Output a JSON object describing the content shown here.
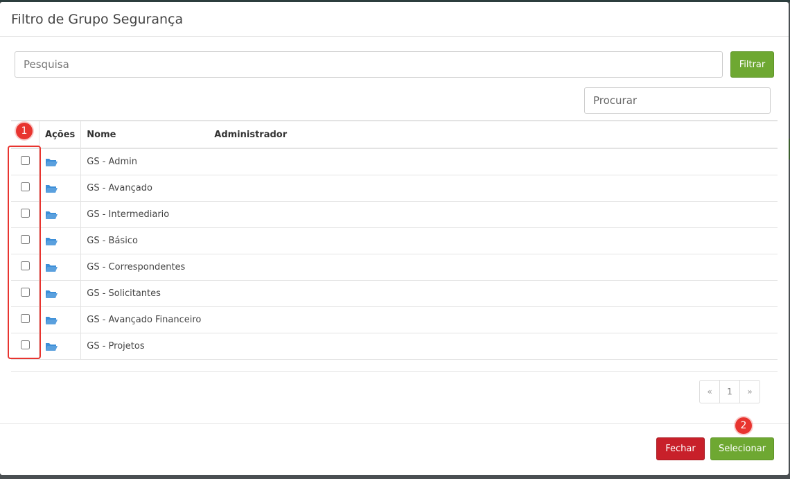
{
  "modal": {
    "title": "Filtro de Grupo Segurança"
  },
  "search": {
    "placeholder": "Pesquisa",
    "value": "",
    "filter_label": "Filtrar"
  },
  "table_search": {
    "placeholder": "Procurar",
    "value": ""
  },
  "table": {
    "headers": {
      "actions": "Ações",
      "name": "Nome",
      "admin": "Administrador"
    },
    "rows": [
      {
        "name": "GS - Admin",
        "checked": false
      },
      {
        "name": "GS - Avançado",
        "checked": false
      },
      {
        "name": "GS - Intermediario",
        "checked": false
      },
      {
        "name": "GS - Básico",
        "checked": false
      },
      {
        "name": "GS - Correspondentes",
        "checked": false
      },
      {
        "name": "GS - Solicitantes",
        "checked": false
      },
      {
        "name": "GS - Avançado Financeiro",
        "checked": false
      },
      {
        "name": "GS - Projetos",
        "checked": false
      }
    ],
    "row_icon": "folder-open-icon"
  },
  "pagination": {
    "prev": "«",
    "current": "1",
    "next": "»"
  },
  "footer": {
    "close_label": "Fechar",
    "select_label": "Selecionar"
  },
  "annotations": {
    "badge_1": "1",
    "badge_2": "2"
  },
  "colors": {
    "success": "#6ea832",
    "danger": "#c8202a",
    "annotation": "#e8342f",
    "folder": "#3d8fd8"
  }
}
